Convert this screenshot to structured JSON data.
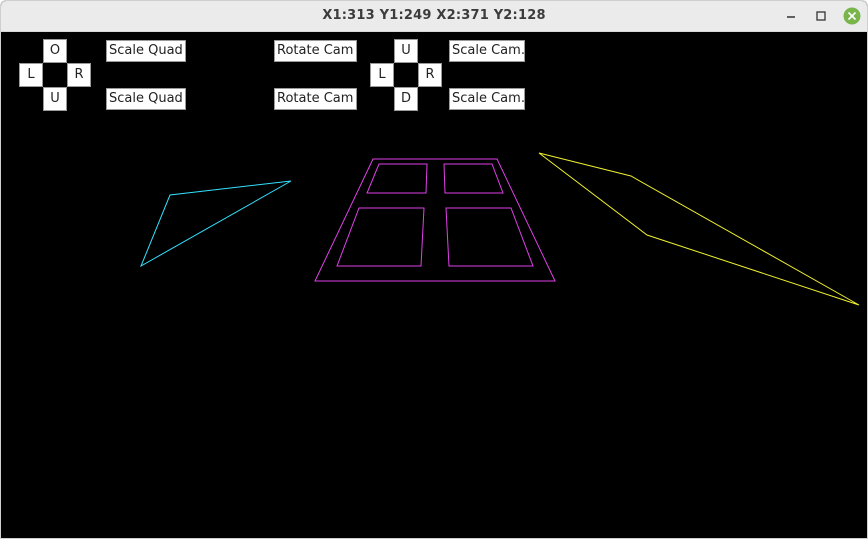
{
  "window": {
    "title": "X1:313  Y1:249  X2:371  Y2:128",
    "controls": {
      "minimize_icon": "minimize-icon",
      "maximize_icon": "maximize-icon",
      "close_icon": "close-icon",
      "close_color": "#78b54a"
    }
  },
  "quad_pad": {
    "up": "O",
    "left": "L",
    "right": "R",
    "down": "U"
  },
  "quad_scale": {
    "plus": "Scale Quad +",
    "minus": "Scale Quad -"
  },
  "cam_rotate": {
    "left": "Rotate Cam L",
    "right": "Rotate Cam R"
  },
  "cam_pad": {
    "up": "U",
    "left": "L",
    "right": "R",
    "down": "D"
  },
  "cam_scale": {
    "plus": "Scale Cam. +",
    "minus": "Scale Cam. -"
  },
  "scene": {
    "background": "#000000",
    "triangle_left_color": "#33e0ff",
    "quad_color": "#e040e8",
    "triangle_right_color": "#f0f030"
  }
}
